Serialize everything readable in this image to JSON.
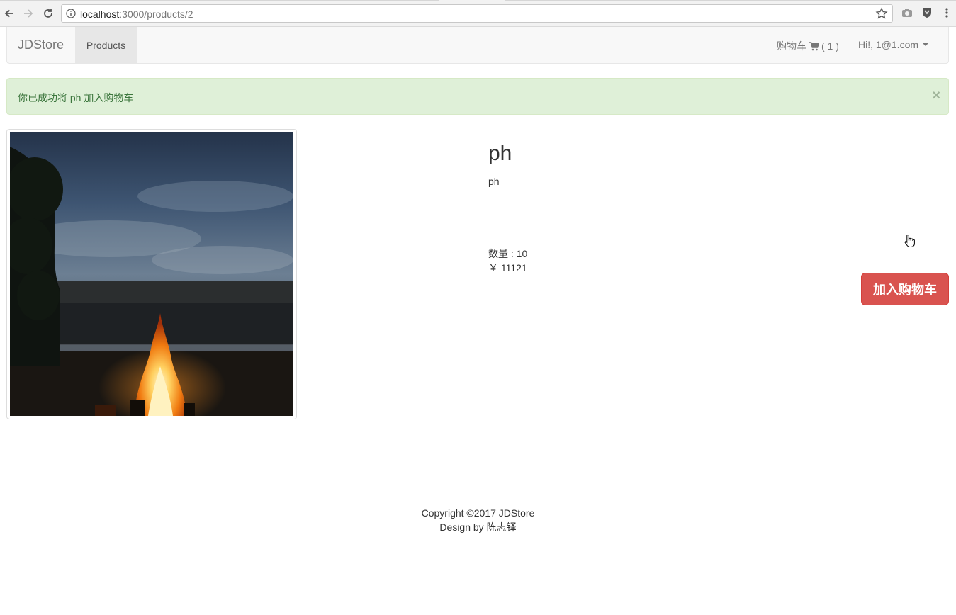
{
  "browser": {
    "url_host": "localhost",
    "url_path": ":3000/products/2"
  },
  "navbar": {
    "brand": "JDStore",
    "products_label": "Products",
    "cart_label": "购物车",
    "cart_count": "( 1 )",
    "user_label": "Hi!, 1@1.com"
  },
  "alert": {
    "message": "你已成功将 ph 加入购物车",
    "close": "×"
  },
  "product": {
    "title": "ph",
    "description": "ph",
    "quantity": "数量 : 10",
    "price": "￥ 11121",
    "add_to_cart_label": "加入购物车"
  },
  "footer": {
    "copyright": "Copyright ©2017 JDStore",
    "design": "Design by 陈志铎"
  }
}
